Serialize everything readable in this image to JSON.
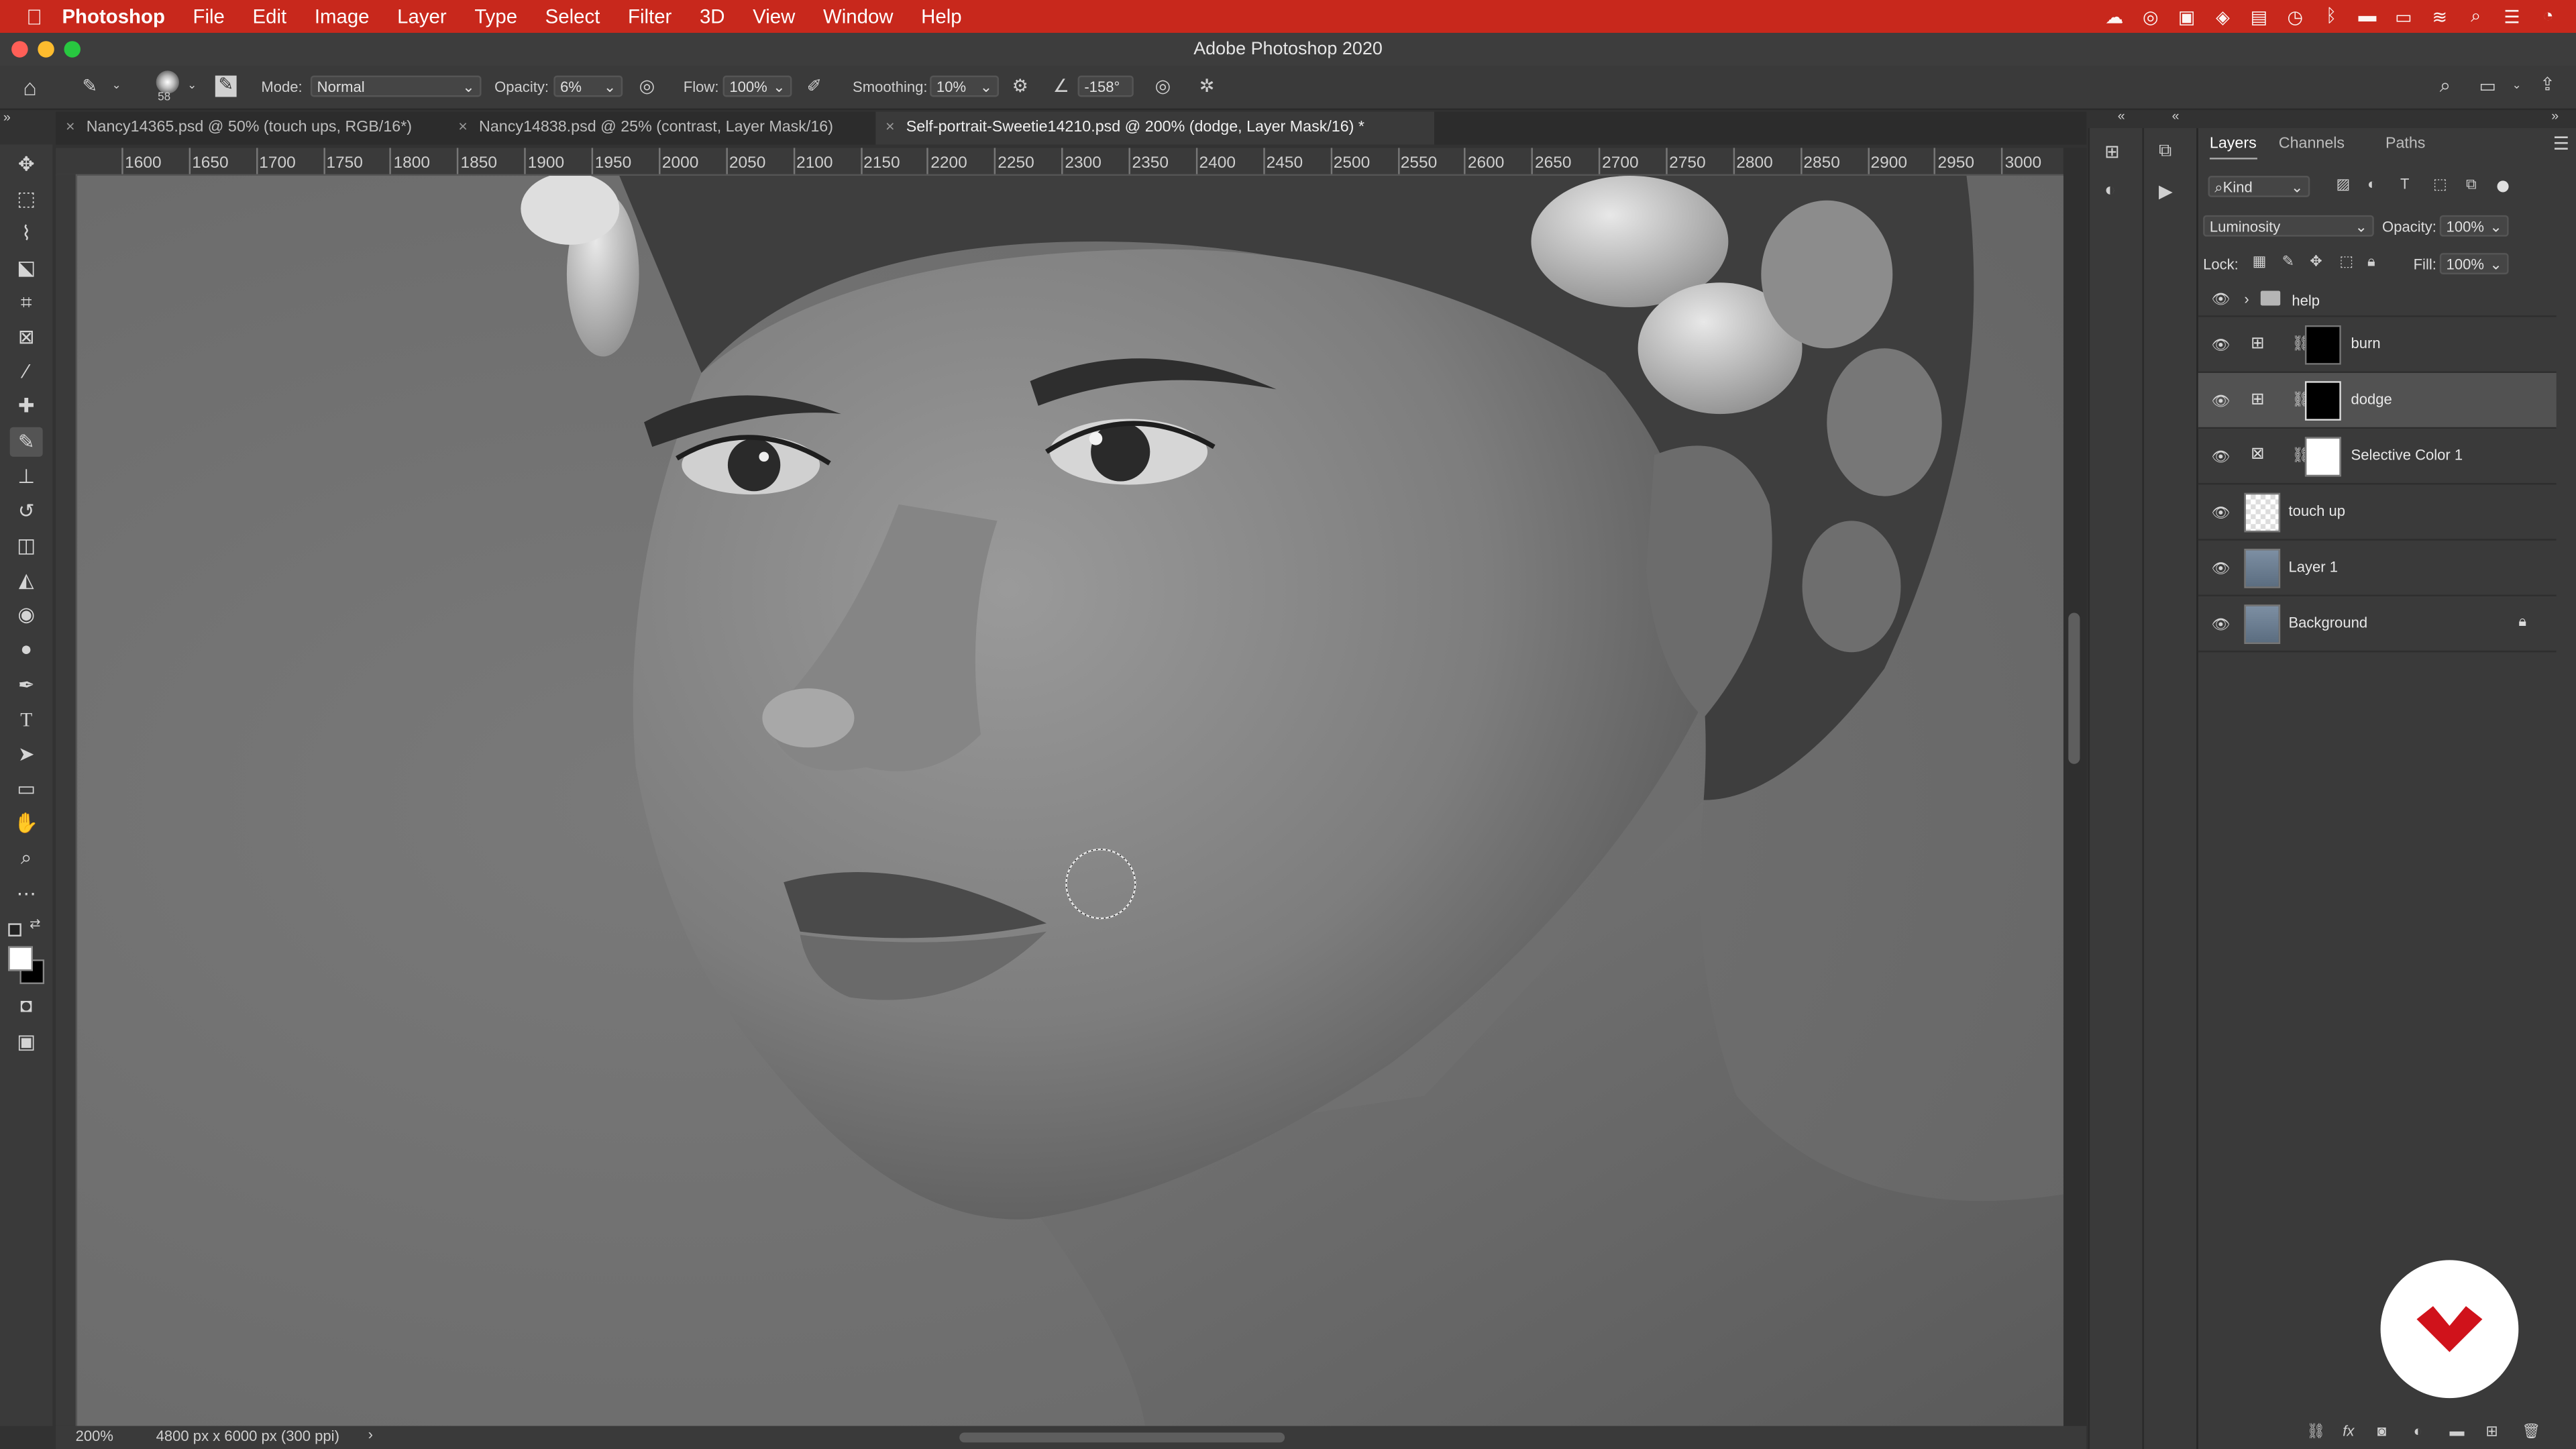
{
  "menubar": {
    "apple": "",
    "app": "Photoshop",
    "items": [
      "File",
      "Edit",
      "Image",
      "Layer",
      "Type",
      "Select",
      "Filter",
      "3D",
      "View",
      "Window",
      "Help"
    ]
  },
  "window_title": "Adobe Photoshop 2020",
  "options": {
    "brush_size": "58",
    "mode_label": "Mode:",
    "mode_value": "Normal",
    "opacity_label": "Opacity:",
    "opacity_value": "6%",
    "flow_label": "Flow:",
    "flow_value": "100%",
    "smoothing_label": "Smoothing:",
    "smoothing_value": "10%",
    "angle_value": "-158°"
  },
  "tabs": [
    {
      "label": "Nancy14365.psd @ 50% (touch ups, RGB/16*)"
    },
    {
      "label": "Nancy14838.psd @ 25% (contrast, Layer Mask/16)"
    },
    {
      "label": "Self-portrait-Sweetie14210.psd @ 200% (dodge, Layer Mask/16) *"
    }
  ],
  "ruler_ticks": [
    "1600",
    "1650",
    "1700",
    "1750",
    "1800",
    "1850",
    "1900",
    "1950",
    "2000",
    "2050",
    "2100",
    "2150",
    "2200",
    "2250",
    "2300",
    "2350",
    "2400",
    "2450",
    "2500",
    "2550",
    "2600",
    "2650",
    "2700",
    "2750",
    "2800",
    "2850",
    "2900",
    "2950",
    "3000"
  ],
  "status": {
    "zoom": "200%",
    "doc_size": "4800 px x 6000 px (300 ppi)"
  },
  "layers_panel": {
    "tabs": [
      "Layers",
      "Channels",
      "Paths"
    ],
    "filter_kind": "Kind",
    "blend_mode": "Luminosity",
    "opacity_label": "Opacity:",
    "opacity_value": "100%",
    "lock_label": "Lock:",
    "fill_label": "Fill:",
    "fill_value": "100%",
    "layers": [
      {
        "name": "help",
        "type": "group"
      },
      {
        "name": "burn",
        "type": "curves-mask"
      },
      {
        "name": "dodge",
        "type": "curves-mask",
        "selected": true
      },
      {
        "name": "Selective Color 1",
        "type": "adjustment-mask"
      },
      {
        "name": "touch up",
        "type": "transparent"
      },
      {
        "name": "Layer 1",
        "type": "image"
      },
      {
        "name": "Background",
        "type": "image-locked"
      }
    ]
  },
  "colors": {
    "menubar_bg": "#c8281c",
    "panel_bg": "#3a3a3a",
    "selected_layer": "#525252",
    "logo_red": "#d0121b"
  }
}
